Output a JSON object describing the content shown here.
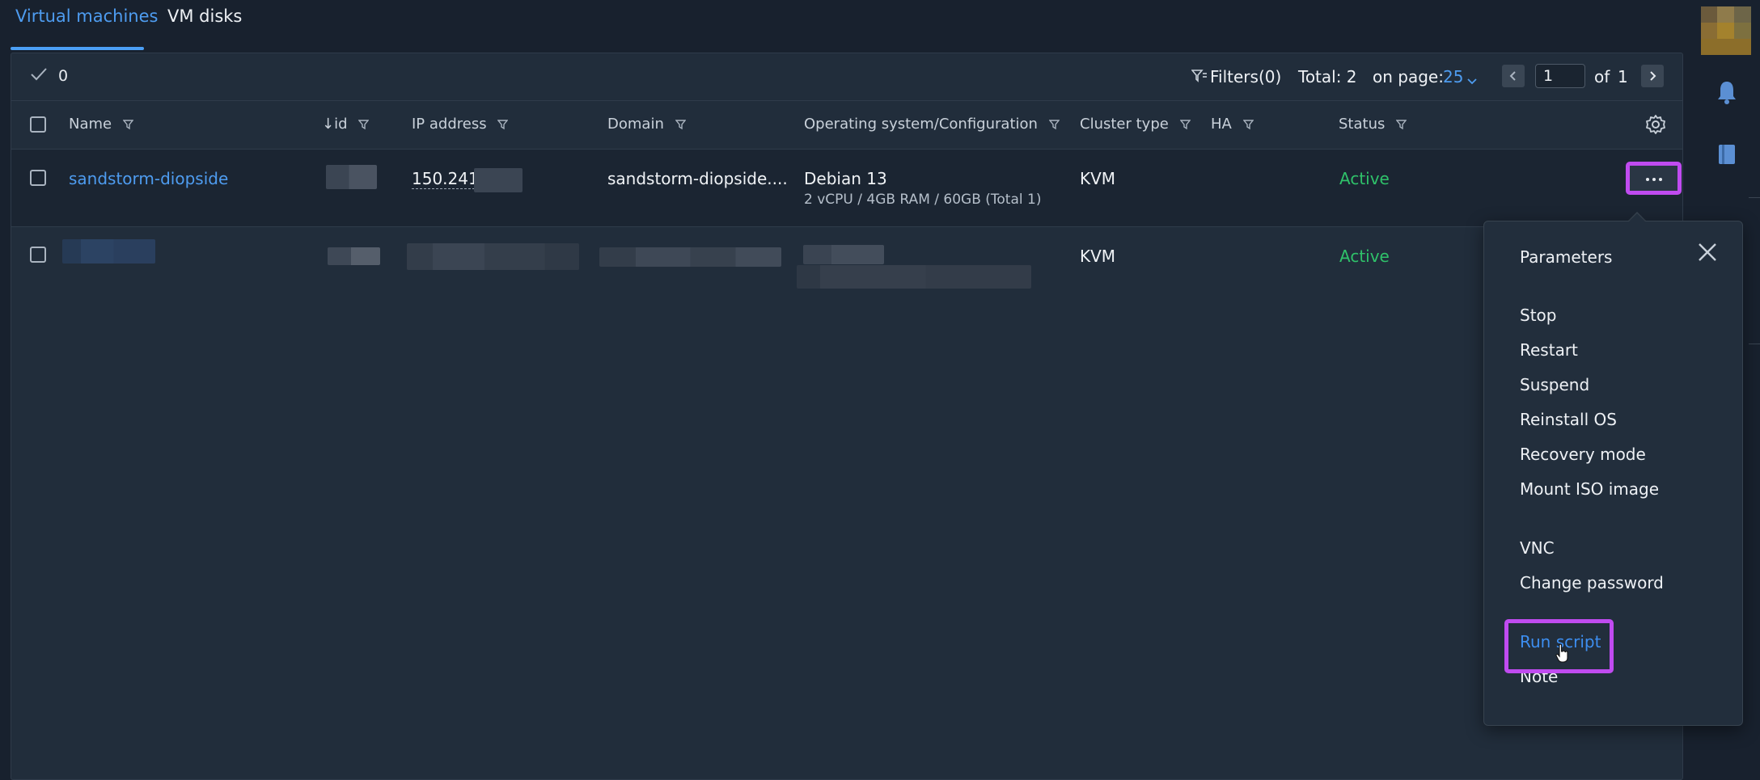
{
  "tabs": [
    {
      "label": "Virtual machines",
      "active": true
    },
    {
      "label": "VM disks",
      "active": false
    }
  ],
  "toolbar": {
    "selected_count": "0",
    "filters_label": "Filters(0)",
    "total_label": "Total: 2",
    "on_page_label": "on page:",
    "on_page_value": "25",
    "current_page": "1",
    "of_label": "of",
    "total_pages": "1"
  },
  "table": {
    "columns": [
      "Name",
      "id",
      "IP address",
      "Domain",
      "Operating system/Configuration",
      "Cluster type",
      "HA",
      "Status"
    ],
    "sort_indicator": "↓",
    "rows": [
      {
        "name": "sandstorm-diopside",
        "ip": "150.241",
        "domain": "sandstorm-diopside....",
        "os": "Debian 13",
        "config": "2 vCPU / 4GB RAM / 60GB (Total 1)",
        "cluster_type": "KVM",
        "status": "Active"
      },
      {
        "cluster_type": "KVM",
        "status": "Active"
      }
    ]
  },
  "context_menu": {
    "items_group1": [
      "Parameters"
    ],
    "items_group2": [
      "Stop",
      "Restart",
      "Suspend",
      "Reinstall OS",
      "Recovery mode",
      "Mount ISO image"
    ],
    "items_group3": [
      "VNC",
      "Change password"
    ],
    "items_group4": [
      "Run script",
      "Note"
    ],
    "active_item": "Run script"
  },
  "colors": {
    "accent": "#4e9cf0",
    "status_active": "#2fc26a",
    "highlight": "#c04bf0",
    "background": "#18212e",
    "panel": "#212d3b"
  },
  "icons": [
    "check-icon",
    "filter-icon",
    "chevron-down-icon",
    "chevron-left-icon",
    "chevron-right-icon",
    "gear-icon",
    "more-icon",
    "close-icon",
    "bell-icon",
    "book-icon",
    "avatar",
    "hand-cursor-icon"
  ]
}
